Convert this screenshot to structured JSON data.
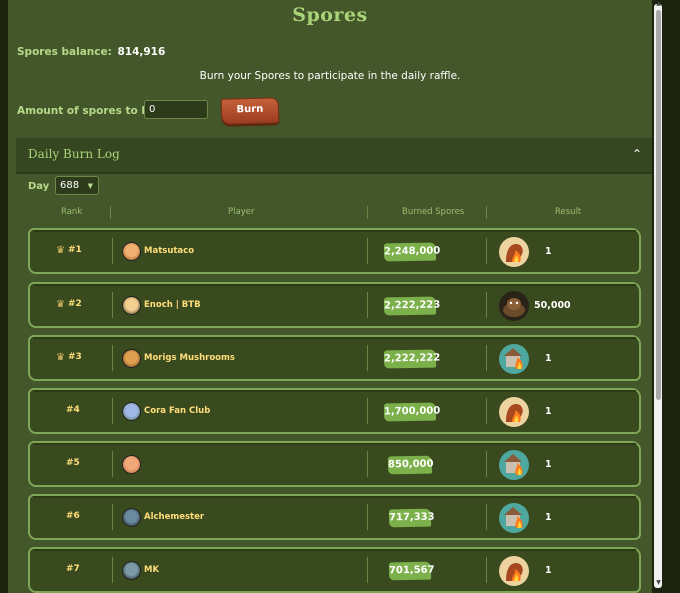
{
  "title": "Spores",
  "balance": {
    "label": "Spores balance:",
    "value": "814,916"
  },
  "intro": "Burn your Spores to participate in the daily raffle.",
  "amount": {
    "label": "Amount of spores to burn:",
    "value": "0"
  },
  "burn_label": "Burn",
  "log": {
    "title": "Daily Burn Log",
    "day_label": "Day",
    "day_value": "688",
    "columns": [
      "Rank",
      "Player",
      "Burned Spores",
      "Result"
    ],
    "rows": [
      {
        "rank": "#1",
        "player": "Matsutaco",
        "burned": "2,248,000",
        "result": "1",
        "icon": "mushroom-fire-icon"
      },
      {
        "rank": "#2",
        "player": "Enoch | BTB",
        "burned": "2,222,223",
        "result": "50,000",
        "icon": "spore-pile-icon"
      },
      {
        "rank": "#3",
        "player": "Morigs Mushrooms",
        "burned": "2,222,222",
        "result": "1",
        "icon": "house-fire-icon"
      },
      {
        "rank": "#4",
        "player": "Cora Fan Club",
        "burned": "1,700,000",
        "result": "1",
        "icon": "mushroom-fire-icon"
      },
      {
        "rank": "#5",
        "player": "",
        "burned": "850,000",
        "result": "1",
        "icon": "house-fire-icon"
      },
      {
        "rank": "#6",
        "player": "Alchemester",
        "burned": "717,333",
        "result": "1",
        "icon": "house-fire-icon"
      },
      {
        "rank": "#7",
        "player": "MK",
        "burned": "701,567",
        "result": "1",
        "icon": "mushroom-fire-icon"
      }
    ]
  },
  "colors": {
    "background": "#44572a",
    "accent": "#a9d47a",
    "row_border": "#7fa657",
    "pill": "#7bb04a",
    "burn_button": "#b34a2a",
    "rank_text": "#ffde7a"
  }
}
